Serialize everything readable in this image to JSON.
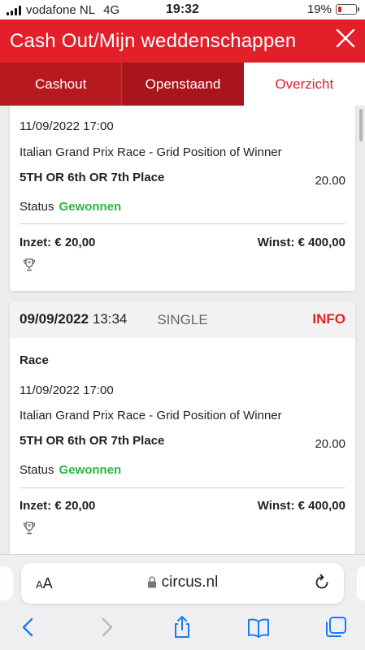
{
  "statusbar": {
    "carrier": "vodafone NL",
    "network": "4G",
    "time": "19:32",
    "battery": "19%"
  },
  "header": {
    "title": "Cash Out/Mijn weddenschappen",
    "close_icon": "close-icon"
  },
  "tabs": [
    {
      "label": "Cashout",
      "active": false
    },
    {
      "label": "Openstaand",
      "active": false
    },
    {
      "label": "Overzicht",
      "active": true
    }
  ],
  "bets": [
    {
      "event_date": "11/09/2022 17:00",
      "market": "Italian Grand Prix Race - Grid Position of Winner",
      "selection": "5TH OR 6th OR 7th Place",
      "odds": "20.00",
      "status_label": "Status",
      "status": "Gewonnen",
      "stake": "Inzet: € 20,00",
      "win": "Winst: € 400,00"
    },
    {
      "placed_date": "09/09/2022",
      "placed_time": "13:34",
      "type": "SINGLE",
      "info": "INFO",
      "event": "Race",
      "event_date": "11/09/2022 17:00",
      "market": "Italian Grand Prix Race - Grid Position of Winner",
      "selection": "5TH OR 6th OR 7th Place",
      "odds": "20.00",
      "status_label": "Status",
      "status": "Gewonnen",
      "stake": "Inzet: € 20,00",
      "win": "Winst: € 400,00"
    }
  ],
  "browser": {
    "text_size": "AA",
    "url": "circus.nl"
  },
  "colors": {
    "brand": "#e3202a",
    "won": "#2fb344"
  }
}
